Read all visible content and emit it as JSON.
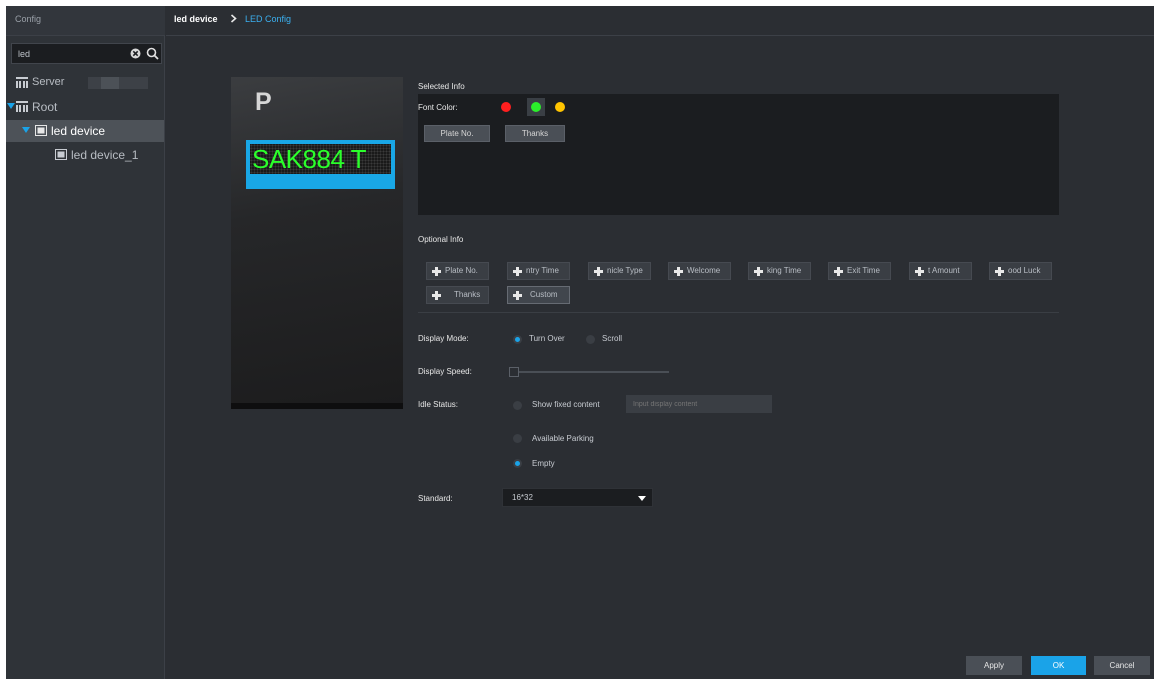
{
  "sidebar": {
    "title": "Config",
    "search": {
      "value": "led",
      "placeholder": ""
    },
    "tree": {
      "server_label": "Server",
      "root_label": "Root",
      "device_label": "led device",
      "child_label": "led device_1"
    }
  },
  "breadcrumb": {
    "device": "led device",
    "current": "LED Config"
  },
  "preview": {
    "logo": "P",
    "plate_text": "SAK884 T"
  },
  "selected_info": {
    "title": "Selected Info",
    "font_color_label": "Font Color:",
    "colors": [
      {
        "name": "red",
        "hex": "#ff1f1f",
        "selected": false
      },
      {
        "name": "green",
        "hex": "#2bef2b",
        "selected": true
      },
      {
        "name": "yellow",
        "hex": "#ffc400",
        "selected": false
      }
    ],
    "chips": [
      "Plate No.",
      "Thanks"
    ]
  },
  "optional_info": {
    "title": "Optional Info",
    "row1": [
      "Plate No.",
      "ntry Time",
      "nicle Type",
      "Welcome",
      "king Time",
      "Exit Time",
      "t Amount",
      "ood Luck"
    ],
    "row2": [
      "Thanks",
      "Custom"
    ]
  },
  "display_mode": {
    "label": "Display Mode:",
    "options": [
      "Turn Over",
      "Scroll"
    ],
    "selected": "Turn Over"
  },
  "display_speed": {
    "label": "Display Speed:",
    "value_fraction": 0
  },
  "idle_status": {
    "label": "Idle Status:",
    "show_fixed_label": "Show fixed content",
    "fixed_placeholder": "Input display content",
    "available_parking_label": "Available Parking",
    "empty_label": "Empty",
    "selected": "Empty"
  },
  "standard": {
    "label": "Standard:",
    "value": "16*32"
  },
  "buttons": {
    "apply": "Apply",
    "ok": "OK",
    "cancel": "Cancel"
  },
  "colors": {
    "accent": "#1aa3e8",
    "background": "#2b2e33",
    "panel": "#1b1d20"
  }
}
